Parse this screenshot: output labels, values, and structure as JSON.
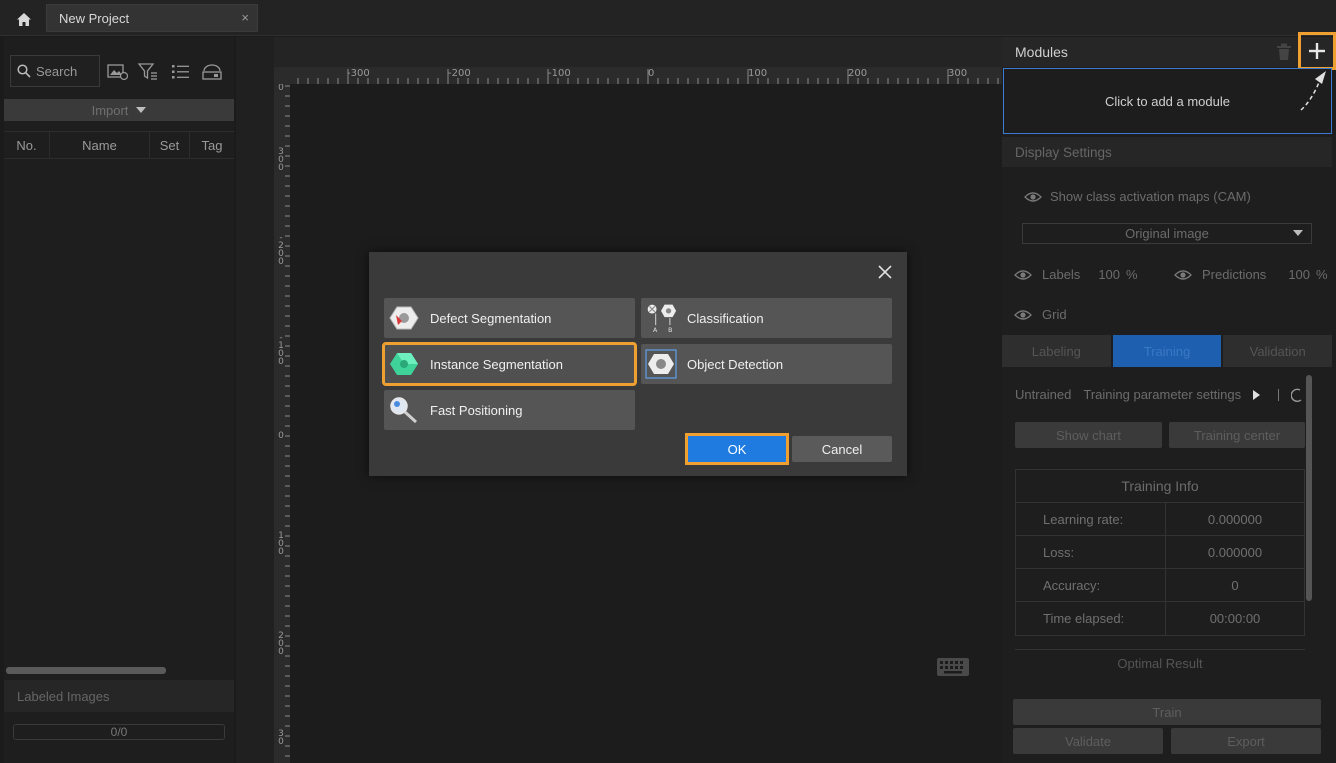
{
  "topbar": {
    "home_icon": "home-icon",
    "tab_title": "New Project",
    "tab_close": "×"
  },
  "left_panel": {
    "search_placeholder": "Search",
    "import_label": "Import",
    "columns": [
      "No.",
      "Name",
      "Set",
      "Tag"
    ],
    "labeled_images_title": "Labeled Images",
    "labeled_progress": "0/0"
  },
  "ruler": {
    "h_labels": [
      "-300",
      "-200",
      "-100",
      "0",
      "100",
      "200",
      "300"
    ],
    "v_labels": [
      "0",
      "3\n0\n0",
      "-\n2\n0\n0",
      "-\n1\n0\n0",
      "0",
      "1\n0\n0",
      "2\n0\n0",
      "3\n0"
    ]
  },
  "right_panel": {
    "modules_title": "Modules",
    "add_module_hint": "Click to add a module",
    "display_settings_title": "Display Settings",
    "cam_label": "Show class activation maps (CAM)",
    "image_select_value": "Original image",
    "labels_label": "Labels",
    "labels_value": "100",
    "labels_unit": "%",
    "predictions_label": "Predictions",
    "predictions_value": "100",
    "predictions_unit": "%",
    "grid_label": "Grid",
    "tabs": [
      "Labeling",
      "Training",
      "Validation"
    ],
    "status": "Untrained",
    "training_params": "Training parameter settings",
    "show_chart": "Show chart",
    "training_center": "Training center",
    "training_info_title": "Training Info",
    "training_info": [
      {
        "k": "Learning rate:",
        "v": "0.000000"
      },
      {
        "k": "Loss:",
        "v": "0.000000"
      },
      {
        "k": "Accuracy:",
        "v": "0"
      },
      {
        "k": "Time elapsed:",
        "v": "00:00:00"
      }
    ],
    "optimal_result": "Optimal Result",
    "train_btn": "Train",
    "validate_btn": "Validate",
    "export_btn": "Export"
  },
  "dialog": {
    "modules": [
      {
        "label": "Defect Segmentation",
        "icon": "defect-segmentation-icon"
      },
      {
        "label": "Classification",
        "icon": "classification-icon"
      },
      {
        "label": "Instance Segmentation",
        "icon": "instance-segmentation-icon"
      },
      {
        "label": "Object Detection",
        "icon": "object-detection-icon"
      },
      {
        "label": "Fast Positioning",
        "icon": "fast-positioning-icon"
      }
    ],
    "selected": "Instance Segmentation",
    "ok_label": "OK",
    "cancel_label": "Cancel"
  },
  "colors": {
    "highlight": "#f0a030",
    "primary": "#1f7be0",
    "accent_tab": "#1f5fb0"
  }
}
